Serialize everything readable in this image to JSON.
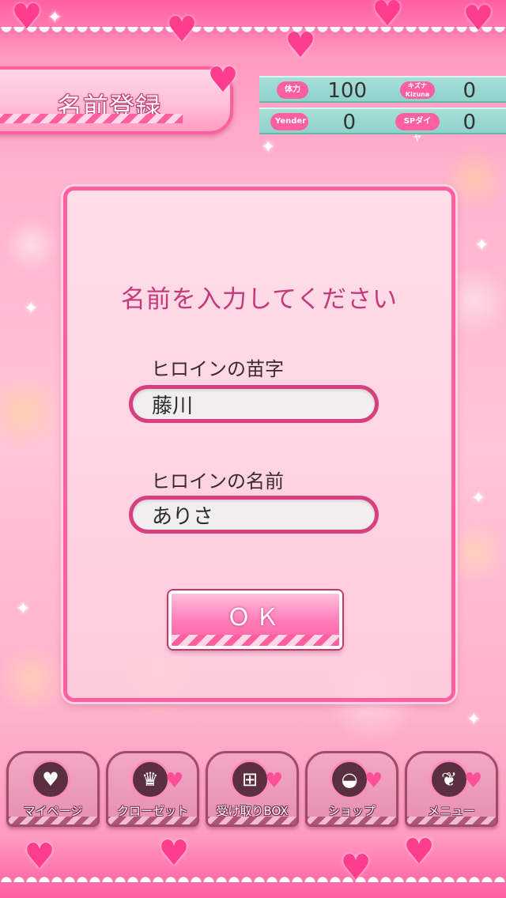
{
  "header": {
    "title": "名前登録",
    "stats": [
      {
        "label": "体力",
        "value": "100"
      },
      {
        "label": "キズナ Kizuna",
        "value": "0"
      },
      {
        "label": "Yender",
        "value": "0"
      },
      {
        "label": "SPダイヤ",
        "value": "0"
      }
    ]
  },
  "dialog": {
    "prompt": "名前を入力してください",
    "surname_label": "ヒロインの苗字",
    "surname_value": "藤川",
    "given_name_label": "ヒロインの名前",
    "given_name_value": "ありさ",
    "ok_label": "ＯＫ"
  },
  "nav": {
    "items": [
      {
        "label": "マイページ",
        "icon": "sp-heart-icon"
      },
      {
        "label": "クローゼット",
        "icon": "dress-icon"
      },
      {
        "label": "受け取りBOX",
        "icon": "gift-icon"
      },
      {
        "label": "ショップ",
        "icon": "bag-icon"
      },
      {
        "label": "メニュー",
        "icon": "menu-hearts-icon"
      }
    ]
  },
  "colors": {
    "accent": "#ff5ea0",
    "stat_bar": "#8ed3cc",
    "prompt_text": "#c33a7a"
  }
}
